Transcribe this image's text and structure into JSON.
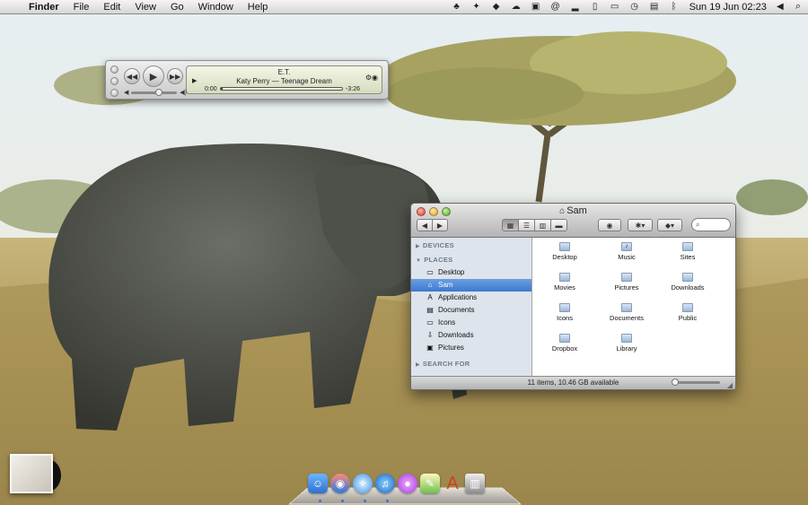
{
  "menubar": {
    "app_name": "Finder",
    "menus": [
      "File",
      "Edit",
      "View",
      "Go",
      "Window",
      "Help"
    ],
    "clock": "Sun 19 Jun  02:23"
  },
  "miniplayer": {
    "title": "E.T.",
    "artist_track": "Katy Perry — Teenage Dream",
    "elapsed": "0:00",
    "remaining": "-3:26",
    "progress": 0.02,
    "volume": 0.6
  },
  "finder": {
    "title": "Sam",
    "sidebar": {
      "devices_header": "DEVICES",
      "places_header": "PLACES",
      "search_header": "SEARCH FOR",
      "places": [
        {
          "label": "Desktop",
          "icon": "desktop-icon"
        },
        {
          "label": "Sam",
          "icon": "home-icon",
          "selected": true
        },
        {
          "label": "Applications",
          "icon": "applications-icon"
        },
        {
          "label": "Documents",
          "icon": "documents-icon"
        },
        {
          "label": "Icons",
          "icon": "folder-icon"
        },
        {
          "label": "Downloads",
          "icon": "downloads-icon"
        },
        {
          "label": "Pictures",
          "icon": "pictures-icon"
        }
      ]
    },
    "items": [
      {
        "label": "Desktop"
      },
      {
        "label": "Music"
      },
      {
        "label": "Sites"
      },
      {
        "label": "Movies"
      },
      {
        "label": "Pictures"
      },
      {
        "label": "Downloads"
      },
      {
        "label": "Icons"
      },
      {
        "label": "Documents"
      },
      {
        "label": "Public"
      },
      {
        "label": "Dropbox"
      },
      {
        "label": "Library"
      }
    ],
    "status": "11 items, 10.46 GB available"
  },
  "dock": {
    "apps": [
      "finder-icon",
      "chat-icon",
      "safari-icon",
      "itunes-icon",
      "messages-icon",
      "notes-icon",
      "textedit-icon",
      "trash-icon"
    ]
  },
  "colors": {
    "selection": "#3d78cf",
    "sidebar_bg": "#dde4ec"
  }
}
